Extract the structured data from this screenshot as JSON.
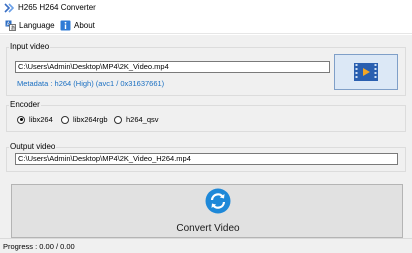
{
  "window": {
    "title": "H265 H264 Converter"
  },
  "menu": {
    "language_label": "Language",
    "about_label": "About",
    "language_icon": "language-icon",
    "about_icon": "info-icon"
  },
  "input_group": {
    "label": "Input video",
    "path": "C:\\Users\\Admin\\Desktop\\MP4\\2K_Video.mp4",
    "metadata": "Metadata : h264 (High) (avc1 / 0x31637661)",
    "browse_icon": "video-file-icon"
  },
  "encoder_group": {
    "label": "Encoder",
    "options": [
      "libx264",
      "libx264rgb",
      "h264_qsv"
    ],
    "selected": "libx264"
  },
  "output_group": {
    "label": "Output video",
    "path": "C:\\Users\\Admin\\Desktop\\MP4\\2K_Video_H264.mp4"
  },
  "convert": {
    "label": "Convert Video",
    "icon": "sync-icon",
    "accent": "#1e88d8"
  },
  "status": {
    "progress_text": "Progress : 0.00 / 0.00"
  }
}
